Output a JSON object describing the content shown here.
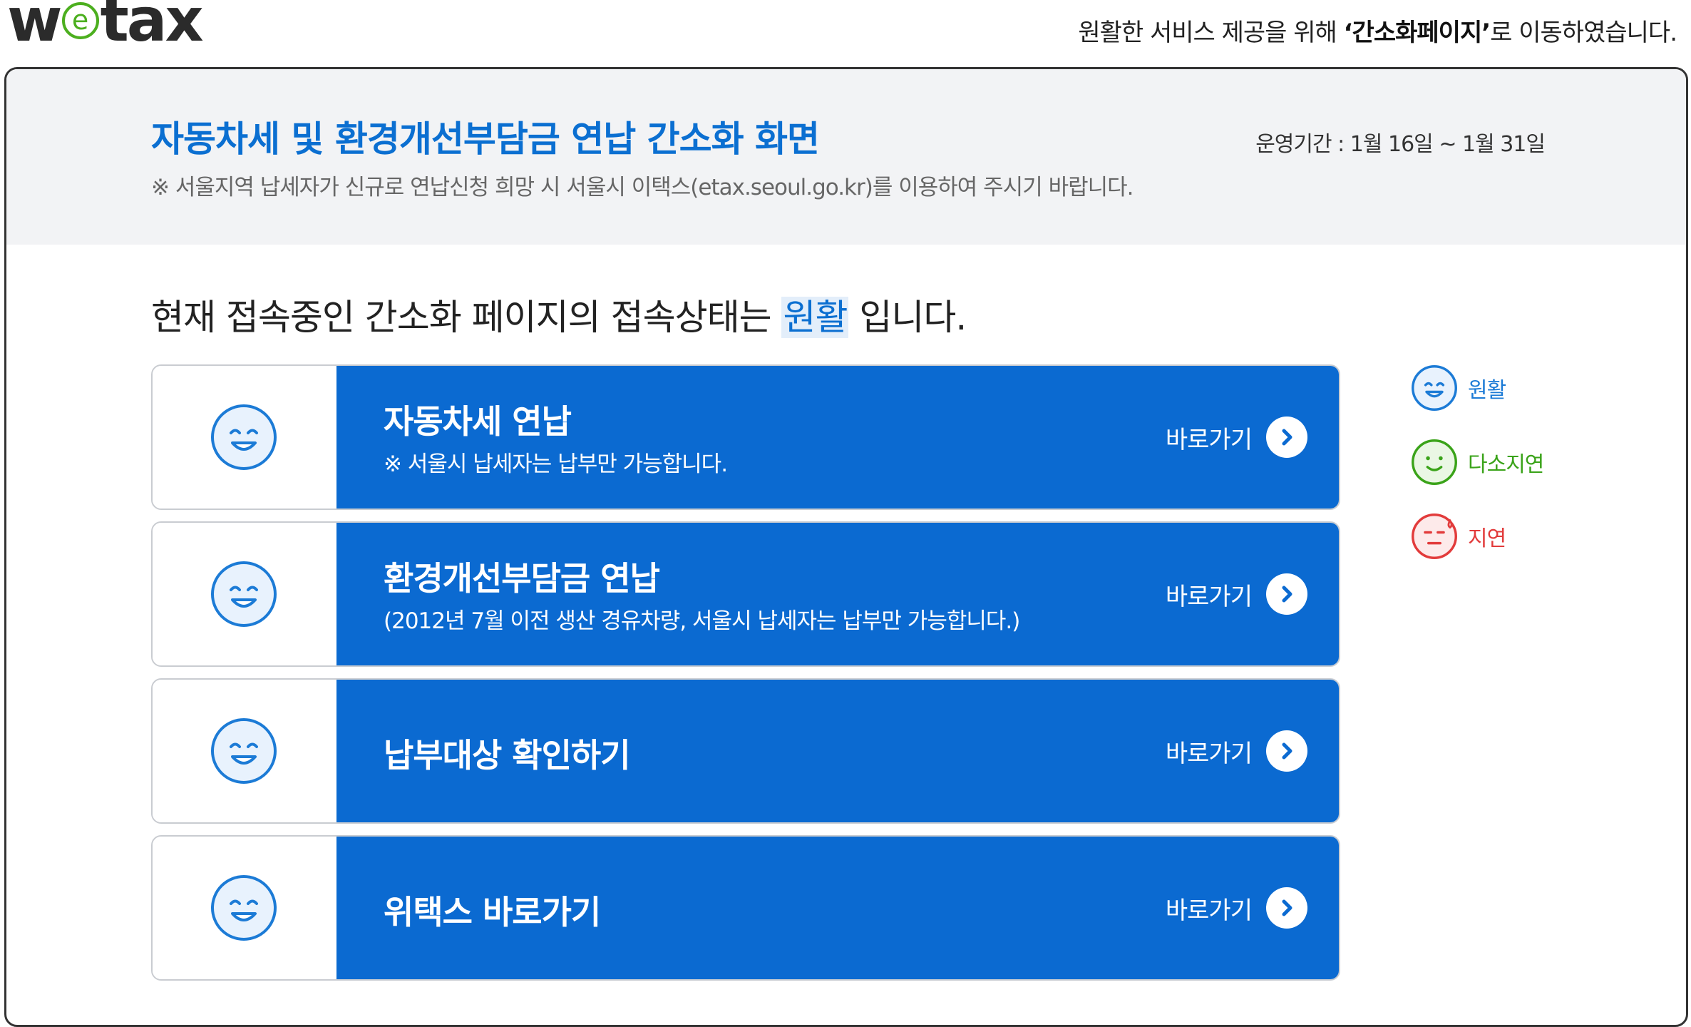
{
  "brand": {
    "logo": "wetax"
  },
  "notice": {
    "prefix": "원활한 서비스 제공을 위해 ",
    "highlight": "‘간소화페이지’",
    "suffix": "로 이동하였습니다."
  },
  "header": {
    "title": "자동차세 및 환경개선부담금 연납 간소화 화면",
    "period": "운영기간 : 1월 16일 ~ 1월 31일",
    "sub_notice": "※ 서울지역 납세자가 신규로 연납신청 희망 시 서울시 이택스(etax.seoul.go.kr)를 이용하여 주시기 바랍니다."
  },
  "status": {
    "prefix": "현재 접속중인 간소화 페이지의 접속상태는 ",
    "value": "원활",
    "suffix": " 입니다."
  },
  "cards": [
    {
      "title": "자동차세 연납",
      "subtitle": "※ 서울시 납세자는 납부만 가능합니다.",
      "go_label": "바로가기"
    },
    {
      "title": "환경개선부담금 연납",
      "subtitle": "(2012년 7월 이전 생산 경유차량, 서울시 납세자는 납부만 가능합니다.)",
      "go_label": "바로가기"
    },
    {
      "title": "납부대상 확인하기",
      "subtitle": "",
      "go_label": "바로가기"
    },
    {
      "title": "위택스 바로가기",
      "subtitle": "",
      "go_label": "바로가기"
    }
  ],
  "legend": [
    {
      "label": "원활",
      "icon": "smile-happy-icon",
      "color": "#1c7bd6"
    },
    {
      "label": "다소지연",
      "icon": "smile-neutral-icon",
      "color": "#3aa319"
    },
    {
      "label": "지연",
      "icon": "smile-sad-icon",
      "color": "#e23b3b"
    }
  ],
  "colors": {
    "brand_blue": "#0b6ad1",
    "title_blue": "#0b6fd1",
    "logo_green": "#4caf1f"
  }
}
